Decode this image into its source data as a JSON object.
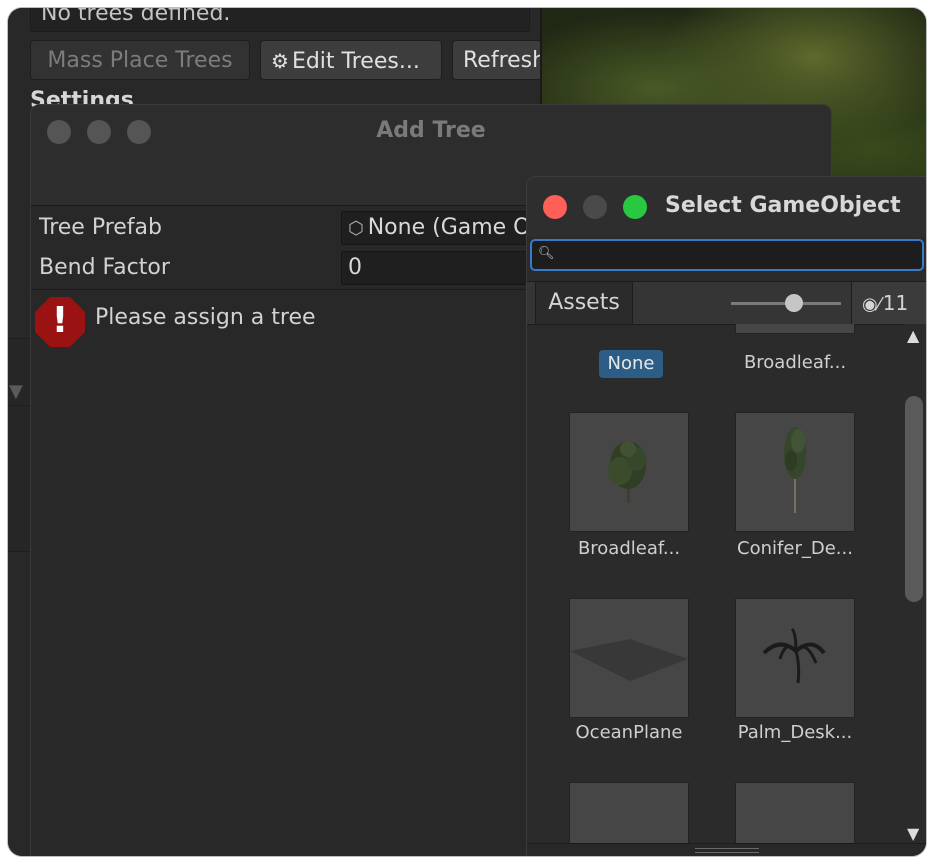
{
  "inspector": {
    "trees_status": "No trees defined.",
    "mass_place_label": "Mass Place Trees",
    "edit_trees_label": "Edit Trees...",
    "refresh_label": "Refresh",
    "settings_label": "Settings"
  },
  "add_tree": {
    "title": "Add Tree",
    "tree_prefab_label": "Tree Prefab",
    "tree_prefab_value": "None (Game Object)",
    "bend_factor_label": "Bend Factor",
    "bend_factor_value": "0",
    "error_message": "Please assign a tree"
  },
  "select_gameobject": {
    "title": "Select GameObject",
    "search_value": "",
    "tab_label": "Assets",
    "hidden_count": "11",
    "items": [
      {
        "label": "None",
        "selected": true
      },
      {
        "label": "Broadleaf..."
      },
      {
        "label": "Broadleaf..."
      },
      {
        "label": "Conifer_De..."
      },
      {
        "label": "OceanPlane"
      },
      {
        "label": "Palm_Desk..."
      }
    ]
  },
  "colors": {
    "selection": "#2c5d87",
    "search_focus": "#3a78c9",
    "error": "#9a1212",
    "close": "#fe5f57",
    "maximize": "#28c840"
  }
}
